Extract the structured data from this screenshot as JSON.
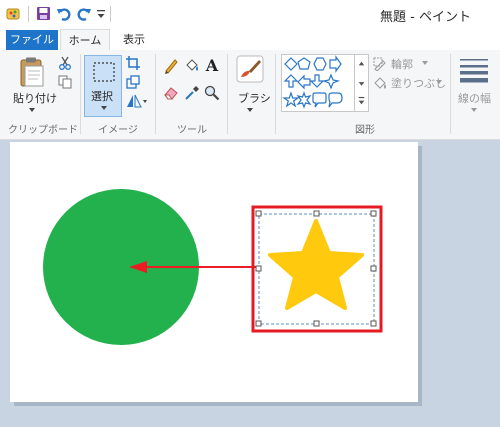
{
  "window": {
    "title": "無題 - ペイント"
  },
  "tabs": [
    {
      "label": "ファイル"
    },
    {
      "label": "ホーム"
    },
    {
      "label": "表示"
    }
  ],
  "ribbon": {
    "clipboard": {
      "paste_label": "貼り付け",
      "group_label": "クリップボード"
    },
    "image": {
      "select_label": "選択",
      "group_label": "イメージ"
    },
    "tools": {
      "text_glyph": "A",
      "group_label": "ツール"
    },
    "brushes": {
      "label": "ブラシ"
    },
    "shapes": {
      "outline_label": "輪郭",
      "fill_label": "塗りつぶし",
      "group_label": "図形"
    },
    "size": {
      "label": "線の幅"
    }
  },
  "colors": {
    "file_tab": "#1e74c8",
    "circle_fill": "#22b14c",
    "star_fill": "#ffc90e",
    "arrow": "#ed1c24",
    "highlight_box": "#e41b23",
    "canvas_bg": "#c9d4e3"
  },
  "icons": [
    "paint-app-icon",
    "save-icon",
    "undo-icon",
    "redo-icon",
    "paste-icon",
    "cut-icon",
    "copy-icon",
    "select-icon",
    "crop-icon",
    "resize-icon",
    "rotate-icon",
    "pencil-icon",
    "fill-icon",
    "text-icon",
    "eraser-icon",
    "color-picker-icon",
    "magnifier-icon",
    "brush-icon",
    "outline-icon",
    "fill-shape-icon",
    "size-icon"
  ]
}
